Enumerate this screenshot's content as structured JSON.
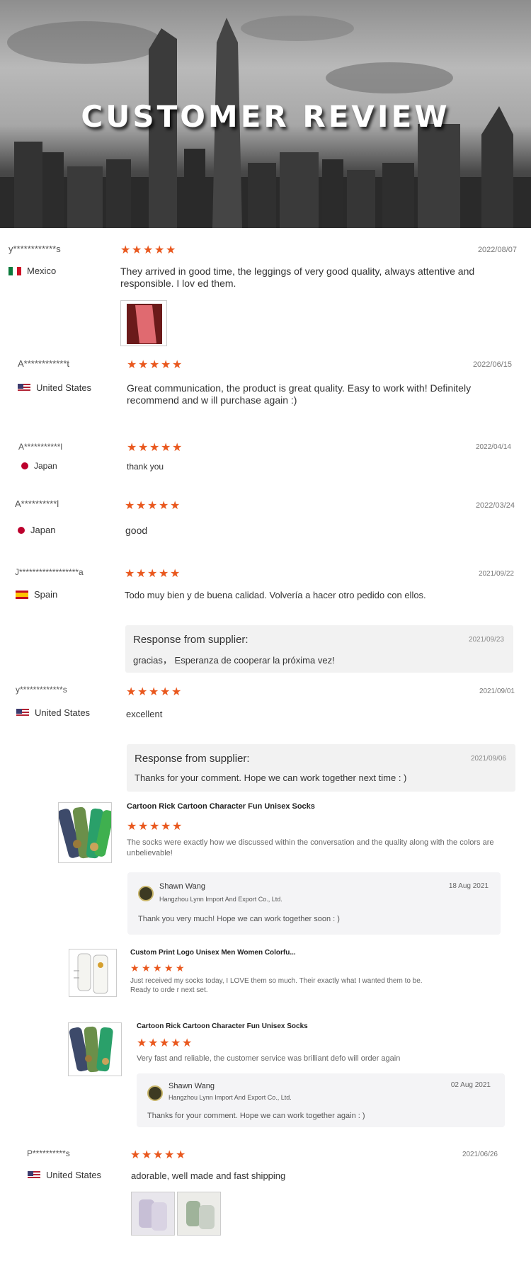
{
  "banner": {
    "title": "CUSTOMER REVIEW"
  },
  "reviews": [
    {
      "name": "y************s",
      "country": "Mexico",
      "date": "2022/08/07",
      "text": "They arrived in good time, the leggings of very good quality, always attentive and responsible. I lov ed them."
    },
    {
      "name": "A************t",
      "country": "United States",
      "date": "2022/06/15",
      "text": "Great communication, the product is great quality. Easy to work with! Definitely recommend and w ill purchase again :)"
    },
    {
      "name": "A***********l",
      "country": "Japan",
      "date": "2022/04/14",
      "text": "thank you"
    },
    {
      "name": "A**********l",
      "country": "Japan",
      "date": "2022/03/24",
      "text": "good"
    },
    {
      "name": "J******************a",
      "country": "Spain",
      "date": "2021/09/22",
      "text": "Todo muy bien y de buena calidad. Volvería a hacer otro pedido con ellos.",
      "response": {
        "title": "Response from supplier:",
        "date": "2021/09/23",
        "text": "gracias， Esperanza de cooperar la próxima vez!"
      }
    },
    {
      "name": "y*************s",
      "country": "United States",
      "date": "2021/09/01",
      "text": "excellent",
      "response": {
        "title": "Response from supplier:",
        "date": "2021/09/06",
        "text": "Thanks for your comment. Hope we can work together next time : )"
      }
    },
    {
      "name": "P**********s",
      "country": "United States",
      "date": "2021/06/26",
      "text": "adorable, well made and fast shipping"
    }
  ],
  "products": [
    {
      "title": "Cartoon Rick Cartoon Character Fun Unisex Socks",
      "text": "The socks were exactly how we discussed within the conversation and the quality along with the colors are unbelievable!",
      "reply": {
        "name": "Shawn Wang",
        "company": "Hangzhou Lynn Import And Export Co., Ltd.",
        "date": "18 Aug 2021",
        "text": "Thank you very much! Hope we can work together soon : )"
      }
    },
    {
      "title": "Custom Print Logo Unisex Men Women Colorfu...",
      "text": "Just received my socks today, I LOVE them so much. Their exactly what I wanted them to be. Ready to orde r next set."
    },
    {
      "title": "Cartoon Rick Cartoon Character Fun Unisex Socks",
      "text": "Very fast and reliable, the customer service was brilliant defo will order again",
      "reply": {
        "name": "Shawn Wang",
        "company": "Hangzhou Lynn Import And Export Co., Ltd.",
        "date": "02 Aug 2021",
        "text": "Thanks for your comment. Hope we can work together again : )"
      }
    }
  ],
  "colors": {
    "star": "#e9581e",
    "response_bg": "#f2f2f2",
    "card_bg": "#f4f4f6"
  },
  "icons": {
    "star": "star-icon",
    "flag_mexico": "mexico-flag-icon",
    "flag_us": "us-flag-icon",
    "flag_japan": "japan-flag-icon",
    "flag_spain": "spain-flag-icon"
  }
}
